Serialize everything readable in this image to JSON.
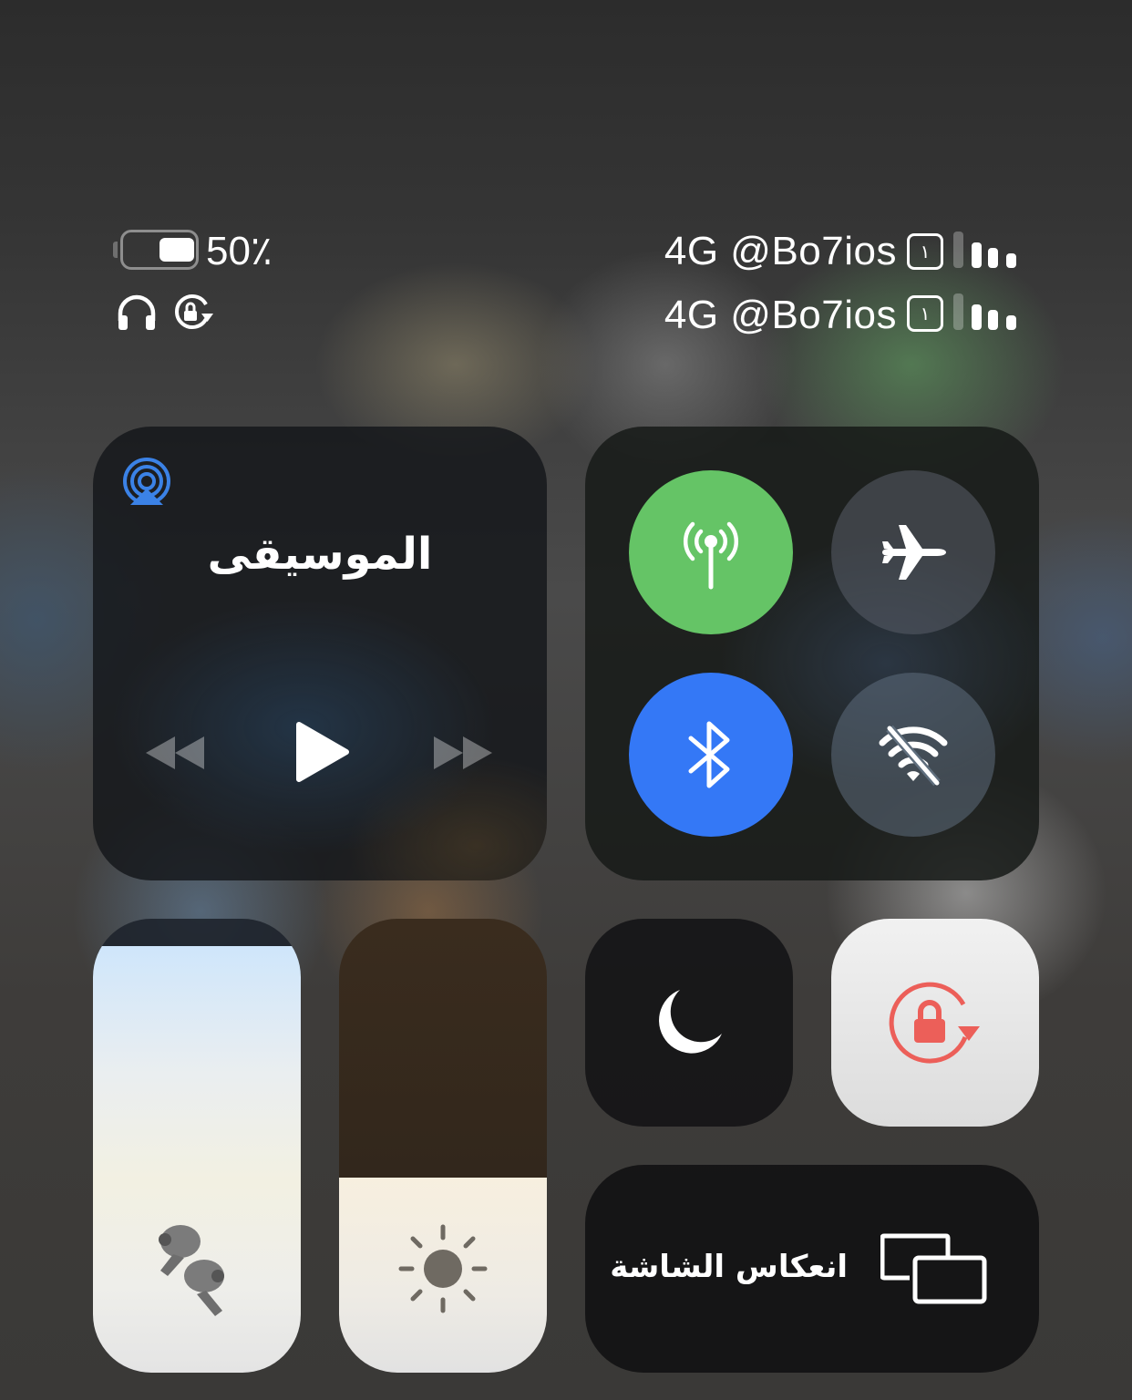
{
  "status_bar": {
    "battery_percent": "50٪",
    "battery_level": 0.5,
    "line1": {
      "carrier": "4G @Bo7ios",
      "sim_badge": "١"
    },
    "line2": {
      "carrier": "4G @Bo7ios",
      "sim_badge": "١"
    },
    "icons": [
      "headphones-icon",
      "orientation-lock-icon"
    ]
  },
  "music": {
    "title": "الموسيقى",
    "icons": [
      "airplay-icon",
      "rewind-icon",
      "play-icon",
      "fast-forward-icon"
    ]
  },
  "connectivity": {
    "cellular": {
      "icon": "cellular-antenna-icon",
      "active": true,
      "color": "#65c466"
    },
    "airplane": {
      "icon": "airplane-icon",
      "active": false
    },
    "bluetooth": {
      "icon": "bluetooth-icon",
      "active": true,
      "color": "#3478f6"
    },
    "wifi": {
      "icon": "wifi-off-icon",
      "active": false
    }
  },
  "volume": {
    "icon": "airpods-pro-icon",
    "level": 0.94
  },
  "brightness": {
    "icon": "sun-icon",
    "level": 0.43
  },
  "do_not_disturb": {
    "icon": "moon-icon",
    "active": false
  },
  "orientation_lock": {
    "icon": "orientation-lock-icon",
    "active": true,
    "color": "#ec5f59"
  },
  "screen_mirroring": {
    "label": "انعكاس الشاشة",
    "icon": "screen-mirroring-icon"
  }
}
